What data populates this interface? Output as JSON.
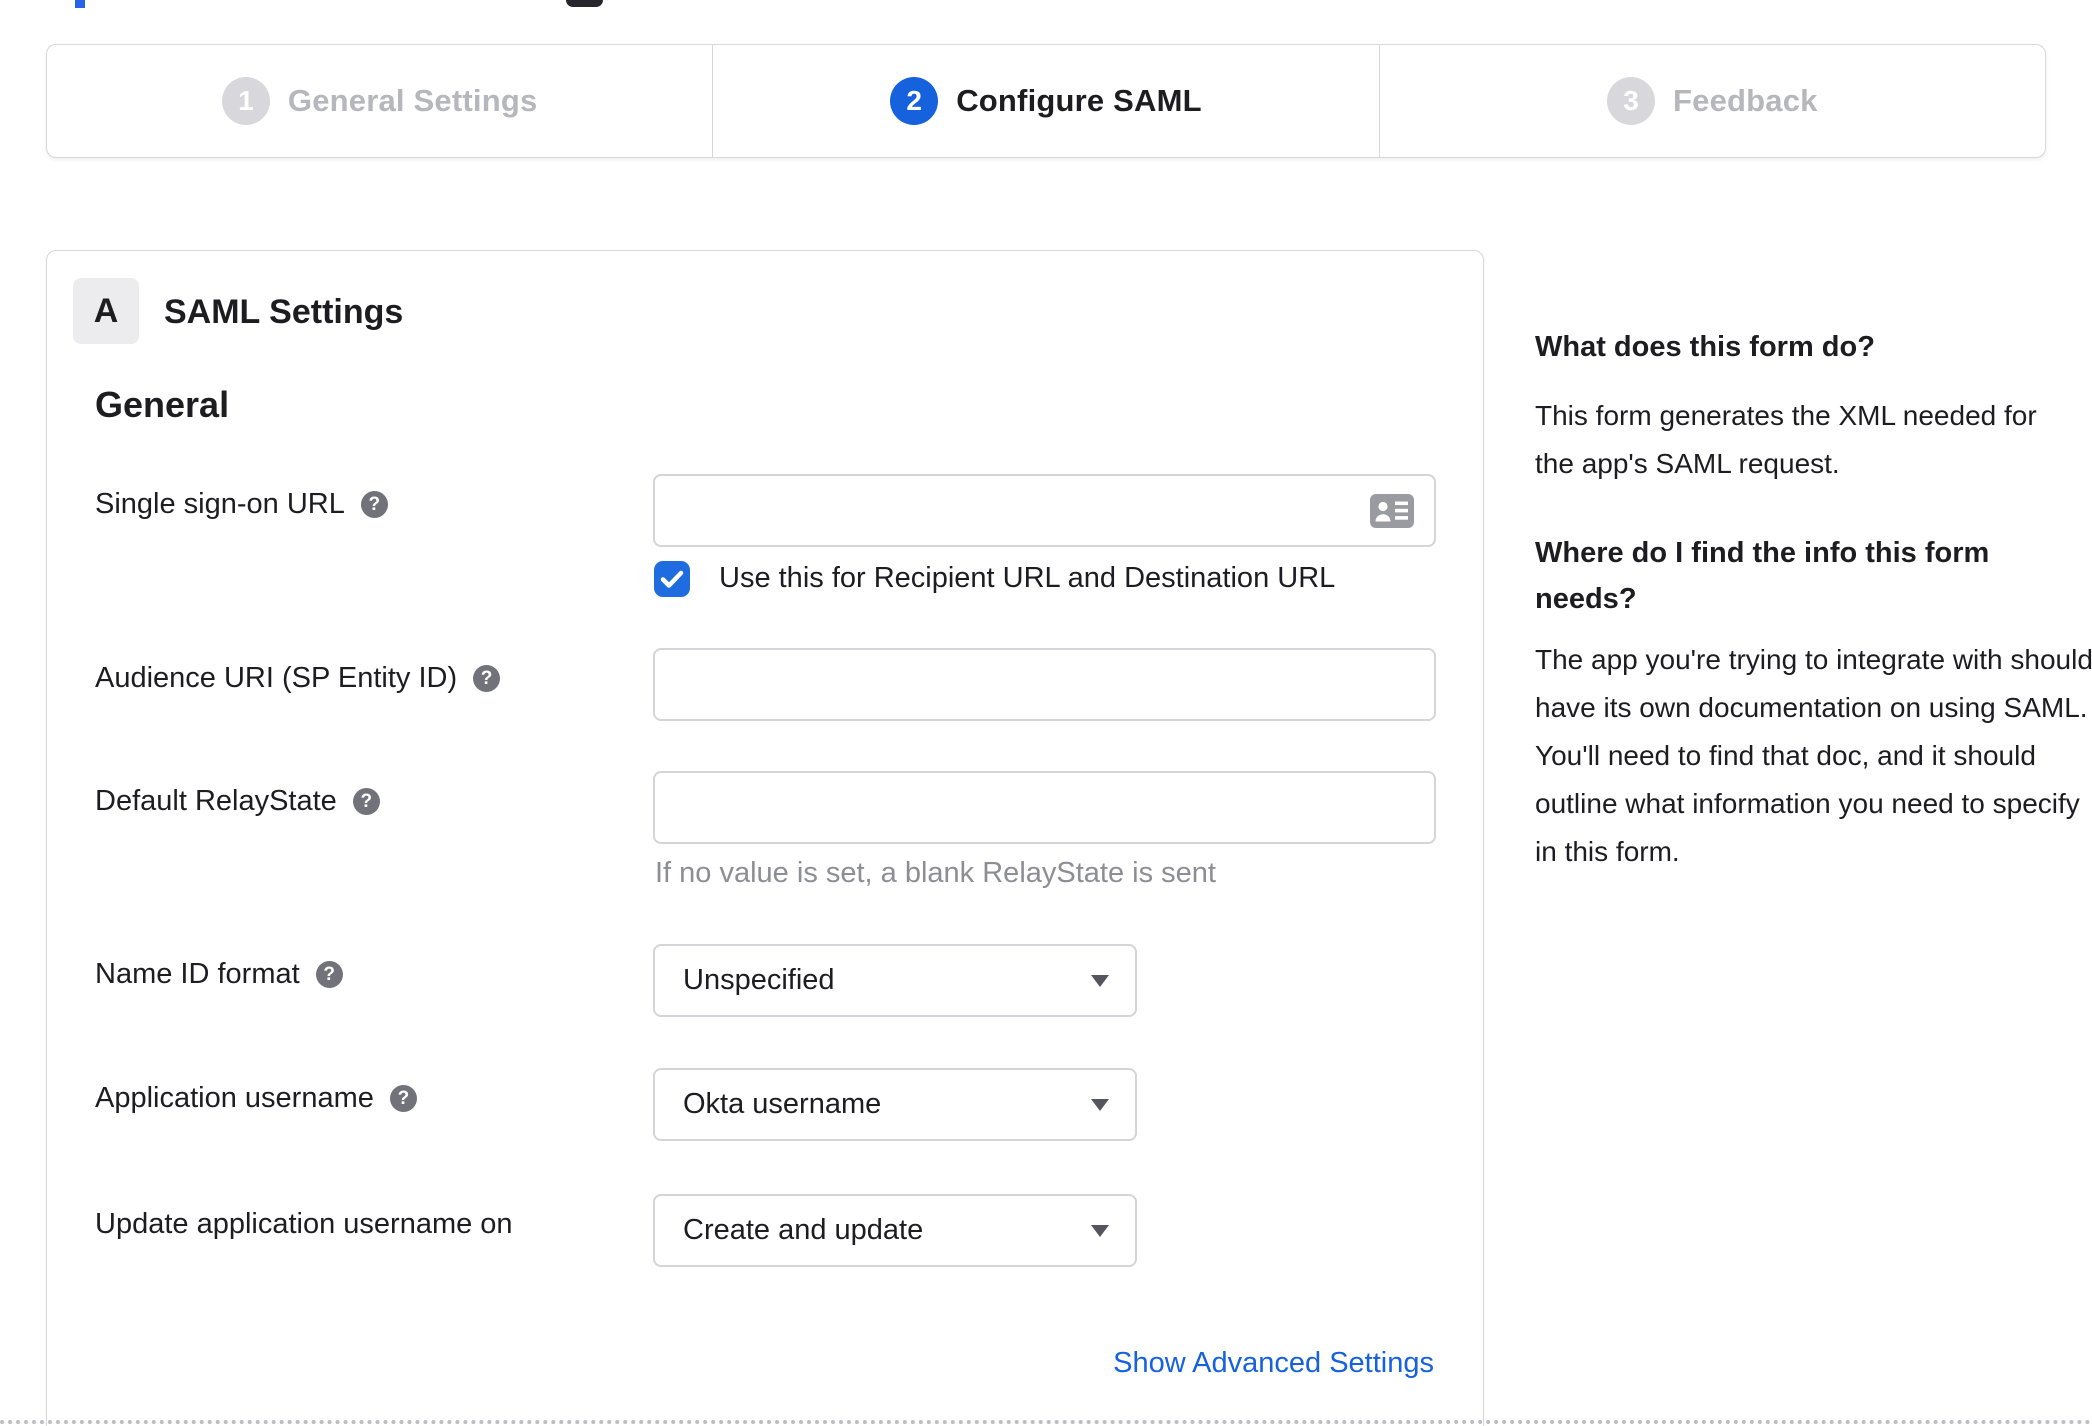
{
  "stepper": {
    "steps": [
      {
        "number": "1",
        "label": "General Settings",
        "state": "inactive"
      },
      {
        "number": "2",
        "label": "Configure SAML",
        "state": "active"
      },
      {
        "number": "3",
        "label": "Feedback",
        "state": "inactive"
      }
    ]
  },
  "saml_panel": {
    "badge": "A",
    "title": "SAML Settings",
    "section_title": "General",
    "fields": {
      "sso": {
        "label": "Single sign-on URL",
        "value": "",
        "checkbox_label": "Use this for Recipient URL and Destination URL",
        "checkbox_checked": true
      },
      "audience": {
        "label": "Audience URI (SP Entity ID)",
        "value": ""
      },
      "relay_state": {
        "label": "Default RelayState",
        "value": "",
        "hint": "If no value is set, a blank RelayState is sent"
      },
      "name_id_format": {
        "label": "Name ID format",
        "value": "Unspecified"
      },
      "application_username": {
        "label": "Application username",
        "value": "Okta username"
      },
      "update_application_username": {
        "label": "Update application username on",
        "value": "Create and update"
      }
    },
    "advanced_link_label": "Show Advanced Settings"
  },
  "help_panel": {
    "heading_1": "What does this form do?",
    "paragraph_1": "This form generates the XML needed for the app's SAML request.",
    "heading_2": "Where do I find the info this form needs?",
    "paragraph_2": "The app you're trying to integrate with should have its own documentation on using SAML. You'll need to find that doc, and it should outline what information you need to specify in this form."
  },
  "icons": {
    "help_glyph": "?"
  },
  "colors": {
    "accent_blue": "#1662dd",
    "checkbox_blue": "#1f6ce1",
    "link_blue": "#1661de",
    "inactive_circle_gray": "#d7d7dc",
    "inactive_label_gray": "#b6b6bd",
    "border_gray": "#d7d7dc",
    "text_dark": "#1d1d21",
    "muted_gray": "#8d8d95"
  }
}
